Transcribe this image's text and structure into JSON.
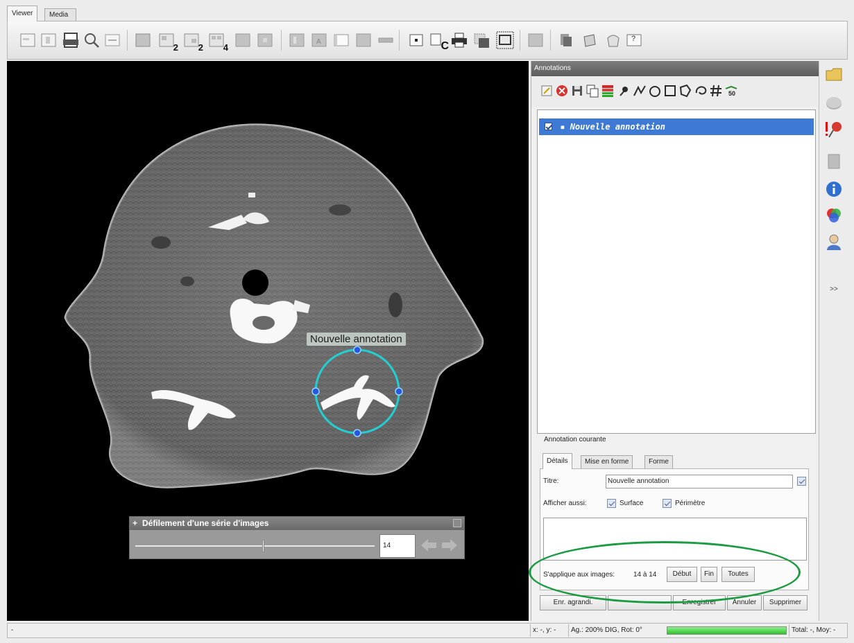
{
  "tabs": [
    "Viewer",
    "Media Gallery"
  ],
  "toolbar": {
    "badges": [
      "2",
      "2",
      "4",
      "C"
    ],
    "help_label": "?"
  },
  "viewer": {
    "annotation_label": "Nouvelle annotation",
    "scroll_panel": {
      "title": "Défilement d'une série d'images",
      "plus": "+",
      "value": "14"
    }
  },
  "annotations_panel": {
    "header": "Annotations",
    "tool_badge": "50",
    "list": [
      {
        "label": "Nouvelle annotation",
        "checked": true
      }
    ],
    "current_label": "Annotation courante",
    "subtabs": [
      "Détails",
      "Mise en forme",
      "Forme"
    ],
    "details": {
      "title_label": "Titre:",
      "title_value": "Nouvelle annotation",
      "show_also_label": "Afficher aussi:",
      "surface_label": "Surface",
      "perimeter_label": "Périmètre",
      "applies_label": "S'applique aux images:",
      "applies_range": "14 à 14",
      "start_button": "Début",
      "end_button": "Fin",
      "all_button": "Toutes"
    },
    "bottom_buttons": [
      "Enr. agrandi.",
      "Enregistrer",
      "Annuler",
      "Supprimer"
    ]
  },
  "side_strip": {
    "more_label": ">>"
  },
  "statusbar": {
    "left": "-",
    "coords": "x: -, y: -",
    "zoom": "Ag.: 200% DIG, Rot: 0°",
    "progress": 1.0,
    "totals": "Total: -, Moy: -"
  },
  "colors": {
    "accent_selection": "#3d79d5",
    "roi_circle": "#22d0d4",
    "highlight_oval": "#1d9b43",
    "progress_fill": "#3ccc3a"
  }
}
